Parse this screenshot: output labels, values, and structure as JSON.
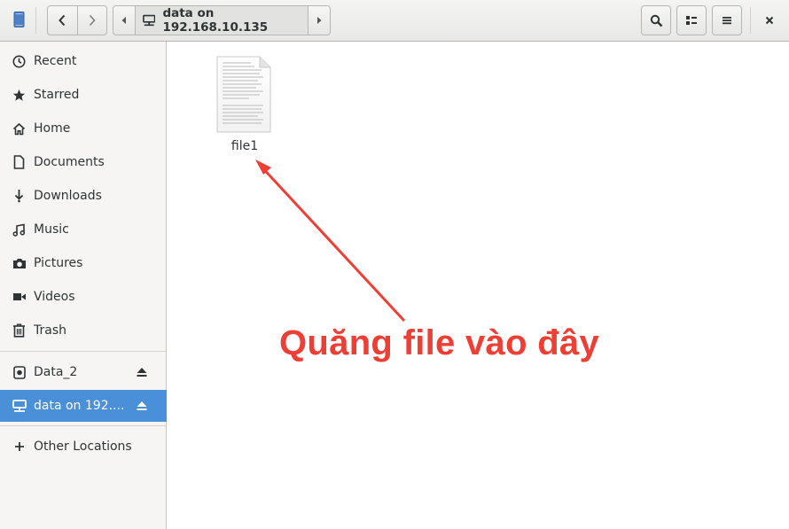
{
  "header": {
    "path_label": "data on 192.168.10.135"
  },
  "sidebar": {
    "items": [
      {
        "label": "Recent",
        "icon": "clock-icon"
      },
      {
        "label": "Starred",
        "icon": "star-icon"
      },
      {
        "label": "Home",
        "icon": "home-icon"
      },
      {
        "label": "Documents",
        "icon": "document-icon"
      },
      {
        "label": "Downloads",
        "icon": "download-icon"
      },
      {
        "label": "Music",
        "icon": "music-icon"
      },
      {
        "label": "Pictures",
        "icon": "camera-icon"
      },
      {
        "label": "Videos",
        "icon": "video-icon"
      },
      {
        "label": "Trash",
        "icon": "trash-icon"
      }
    ],
    "devices": [
      {
        "label": "Data_2",
        "icon": "drive-icon"
      },
      {
        "label": "data on 192....",
        "icon": "network-folder-icon",
        "active": true
      }
    ],
    "other": {
      "label": "Other Locations",
      "icon": "plus-icon"
    }
  },
  "main": {
    "files": [
      {
        "name": "file1",
        "icon": "text-document-icon"
      }
    ],
    "annotation": "Quăng file vào đây"
  },
  "colors": {
    "accent": "#4a90d9",
    "annotation": "#ef3e33"
  }
}
